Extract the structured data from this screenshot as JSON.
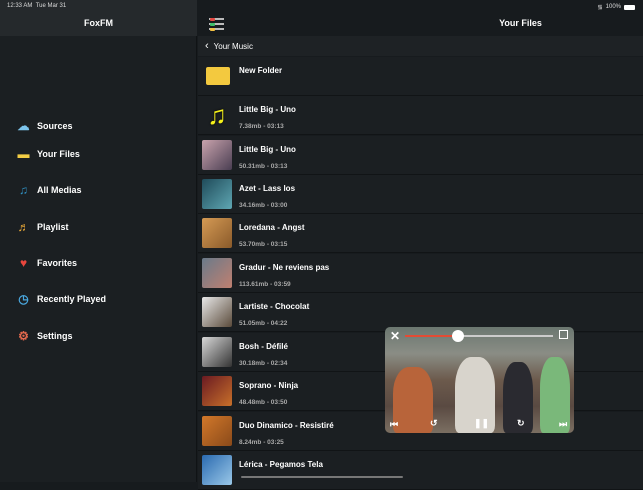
{
  "status": {
    "time": "12:33 AM",
    "date": "Tue Mar 31",
    "battery": "100%"
  },
  "sidebar": {
    "title": "FoxFM",
    "items": [
      {
        "label": "Sources",
        "icon": "cloud-download-icon",
        "color": "#7cc4ec"
      },
      {
        "label": "Your Files",
        "icon": "folder-icon",
        "color": "#f3cd45"
      },
      {
        "label": "All Medias",
        "icon": "music-folder-icon",
        "color": "#2f8fc0"
      },
      {
        "label": "Playlist",
        "icon": "playlist-icon",
        "color": "#e8a838"
      },
      {
        "label": "Favorites",
        "icon": "heart-icon",
        "color": "#e9463d"
      },
      {
        "label": "Recently Played",
        "icon": "clock-icon",
        "color": "#4aa8e0"
      },
      {
        "label": "Settings",
        "icon": "gears-icon",
        "color": "#e56a4e"
      }
    ]
  },
  "header": {
    "title": "Your Files",
    "back_label": "Your Music"
  },
  "files": [
    {
      "name": "New Folder",
      "meta": "",
      "type": "folder"
    },
    {
      "name": "Little Big - Uno",
      "meta": "7.38mb - 03:13",
      "type": "audio"
    },
    {
      "name": "Little Big - Uno",
      "meta": "50.31mb - 03:13",
      "type": "video",
      "c1": "#c9a3ad",
      "c2": "#4a3e52"
    },
    {
      "name": "Azet - Lass los",
      "meta": "34.16mb - 03:00",
      "type": "video",
      "c1": "#1f4b5a",
      "c2": "#5fa7b3"
    },
    {
      "name": "Loredana - Angst",
      "meta": "53.70mb - 03:15",
      "type": "video",
      "c1": "#d59a54",
      "c2": "#8a5a2a"
    },
    {
      "name": "Gradur - Ne reviens pas",
      "meta": "113.61mb - 03:59",
      "type": "video",
      "c1": "#6a7a8a",
      "c2": "#c08070"
    },
    {
      "name": "Lartiste - Chocolat",
      "meta": "51.05mb - 04:22",
      "type": "video",
      "c1": "#e8e8e8",
      "c2": "#5a4a3a"
    },
    {
      "name": "Bosh - Défilé",
      "meta": "30.18mb - 02:34",
      "type": "video",
      "c1": "#d8d8d8",
      "c2": "#333"
    },
    {
      "name": "Soprano - Ninja",
      "meta": "48.48mb - 03:50",
      "type": "video",
      "c1": "#6a1a22",
      "c2": "#c8702a"
    },
    {
      "name": "Duo Dinamico - Resistiré",
      "meta": "8.24mb - 03:25",
      "type": "video",
      "c1": "#d2782a",
      "c2": "#8a4a1a"
    },
    {
      "name": "Lérica - Pegamos Tela",
      "meta": "",
      "type": "video",
      "c1": "#2a6ab0",
      "c2": "#9ac8e8"
    }
  ],
  "player": {
    "progress": 0.36
  }
}
